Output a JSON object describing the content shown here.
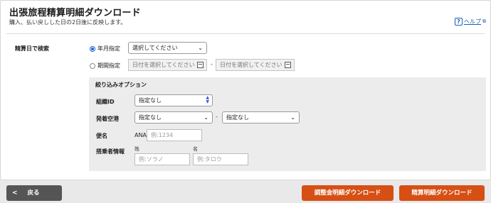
{
  "header": {
    "title": "出張旅程精算明細ダウンロード",
    "subtitle": "購入、払い戻しした日の2日後に反映します。",
    "help_label": "ヘルプ"
  },
  "search": {
    "label": "精算日で検索",
    "month": {
      "label": "年月指定",
      "selected": true,
      "select_value": "選択してください"
    },
    "period": {
      "label": "期間指定",
      "selected": false,
      "from_placeholder": "日付を選択してください",
      "separator": "-",
      "to_placeholder": "日付を選択してください"
    }
  },
  "filters": {
    "title": "絞り込みオプション",
    "org": {
      "label": "組織ID",
      "value": "指定なし"
    },
    "airport": {
      "label": "発着空港",
      "from_value": "指定なし",
      "separator": "-",
      "to_value": "指定なし"
    },
    "flight": {
      "label": "便名",
      "prefix": "ANA",
      "placeholder": "例:1234"
    },
    "passenger": {
      "label": "搭乗者情報",
      "last_label": "姓",
      "last_placeholder": "例:ソラノ",
      "first_label": "名",
      "first_placeholder": "例:タロウ"
    }
  },
  "footer": {
    "back_label": "戻る",
    "adjust_download_label": "調整金明細ダウンロード",
    "detail_download_label": "精算明細ダウンロード"
  },
  "colors": {
    "accent_orange": "#d64f14",
    "back_button": "#555555",
    "radio_blue": "#1a66d2",
    "link_blue": "#1a5fb4"
  }
}
